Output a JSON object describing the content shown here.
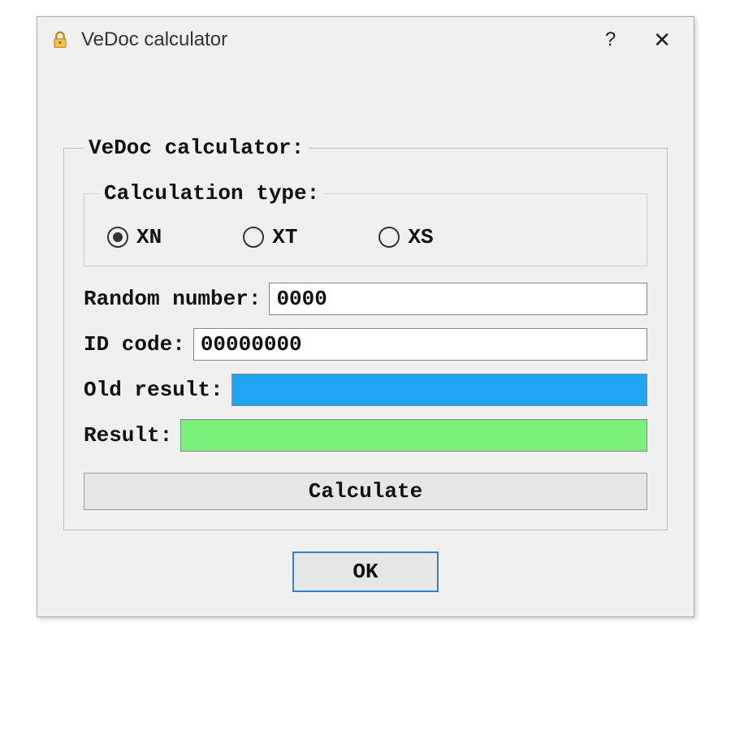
{
  "window": {
    "title": "VeDoc calculator"
  },
  "form": {
    "heading": "VeDoc calculator:",
    "calc_type": {
      "legend": "Calculation type:",
      "options": [
        {
          "label": "XN",
          "selected": true
        },
        {
          "label": "XT",
          "selected": false
        },
        {
          "label": "XS",
          "selected": false
        }
      ]
    },
    "random_number": {
      "label": "Random number:",
      "value": "0000"
    },
    "id_code": {
      "label": "ID code:",
      "value": "00000000"
    },
    "old_result": {
      "label": "Old result:",
      "value": ""
    },
    "result": {
      "label": "Result:",
      "value": ""
    },
    "calculate_label": "Calculate"
  },
  "buttons": {
    "ok_label": "OK"
  },
  "colors": {
    "old_result_bg": "#1fa5f2",
    "result_bg": "#7af07a"
  }
}
